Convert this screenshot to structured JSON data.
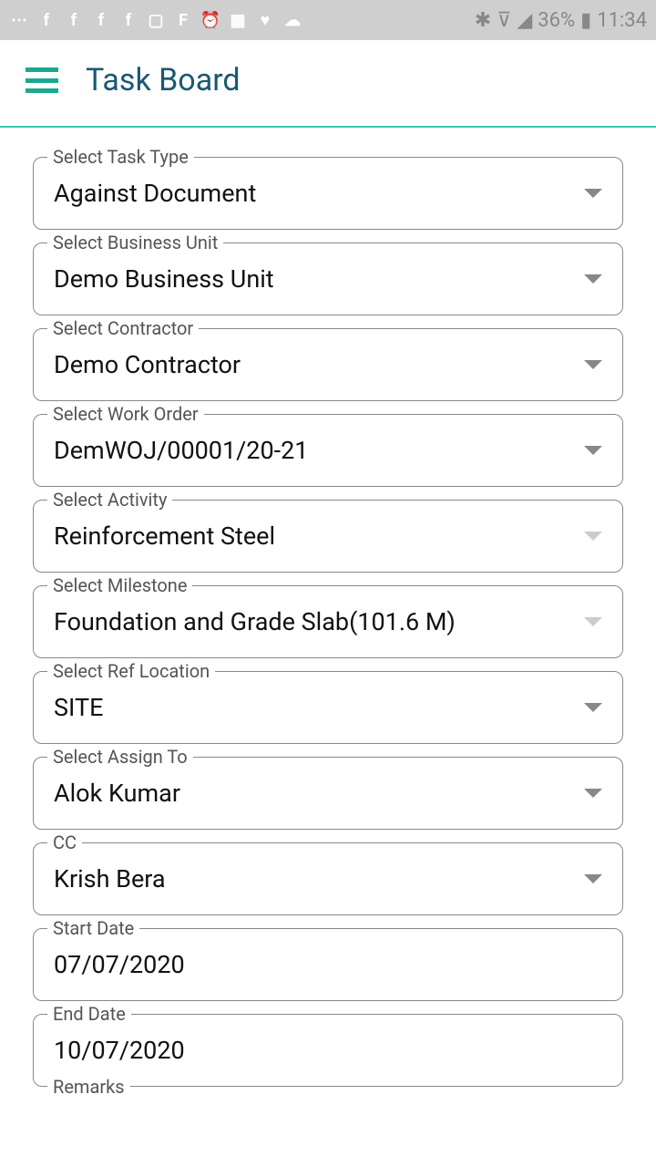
{
  "statusBar": {
    "battery": "36%",
    "time": "11:34"
  },
  "header": {
    "title": "Task Board"
  },
  "fields": {
    "taskType": {
      "label": "Select Task Type",
      "value": "Against Document"
    },
    "businessUnit": {
      "label": "Select Business Unit",
      "value": "Demo Business Unit"
    },
    "contractor": {
      "label": "Select Contractor",
      "value": "Demo Contractor"
    },
    "workOrder": {
      "label": "Select Work Order",
      "value": "DemWOJ/00001/20-21"
    },
    "activity": {
      "label": "Select Activity",
      "value": "Reinforcement Steel"
    },
    "milestone": {
      "label": "Select Milestone",
      "value": "Foundation and Grade Slab(101.6 M)"
    },
    "refLocation": {
      "label": "Select Ref Location",
      "value": "SITE"
    },
    "assignTo": {
      "label": "Select Assign To",
      "value": "Alok Kumar"
    },
    "cc": {
      "label": "CC",
      "value": "Krish Bera"
    },
    "startDate": {
      "label": "Start Date",
      "value": "07/07/2020"
    },
    "endDate": {
      "label": "End Date",
      "value": "10/07/2020"
    },
    "remarks": {
      "label": "Remarks"
    }
  }
}
